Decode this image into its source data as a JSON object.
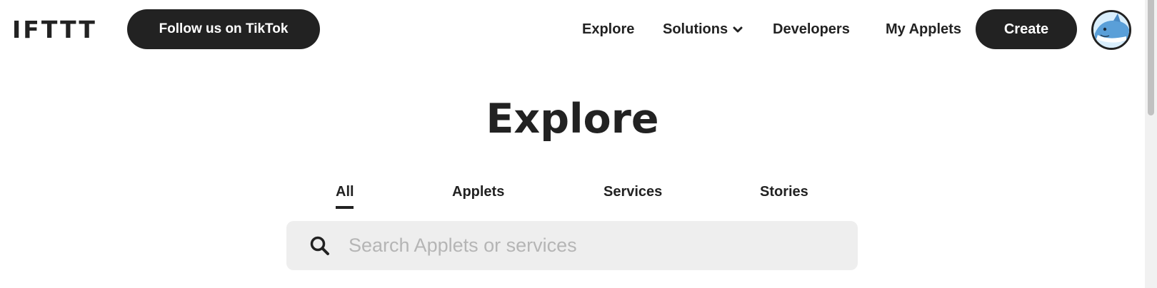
{
  "header": {
    "logo": "IFTTT",
    "tiktok_button": "Follow us on TikTok",
    "nav": {
      "explore": "Explore",
      "solutions": "Solutions",
      "developers": "Developers",
      "my_applets": "My Applets"
    },
    "create_button": "Create",
    "avatar_icon": "shark-avatar-icon"
  },
  "main": {
    "title": "Explore",
    "tabs": [
      {
        "label": "All",
        "active": true
      },
      {
        "label": "Applets",
        "active": false
      },
      {
        "label": "Services",
        "active": false
      },
      {
        "label": "Stories",
        "active": false
      }
    ],
    "search": {
      "placeholder": "Search Applets or services",
      "value": ""
    }
  },
  "colors": {
    "text": "#222222",
    "button_bg": "#222222",
    "button_text": "#ffffff",
    "search_bg": "#eeeeee",
    "placeholder": "#b5b5b5",
    "avatar_bg": "#d9eefc"
  }
}
